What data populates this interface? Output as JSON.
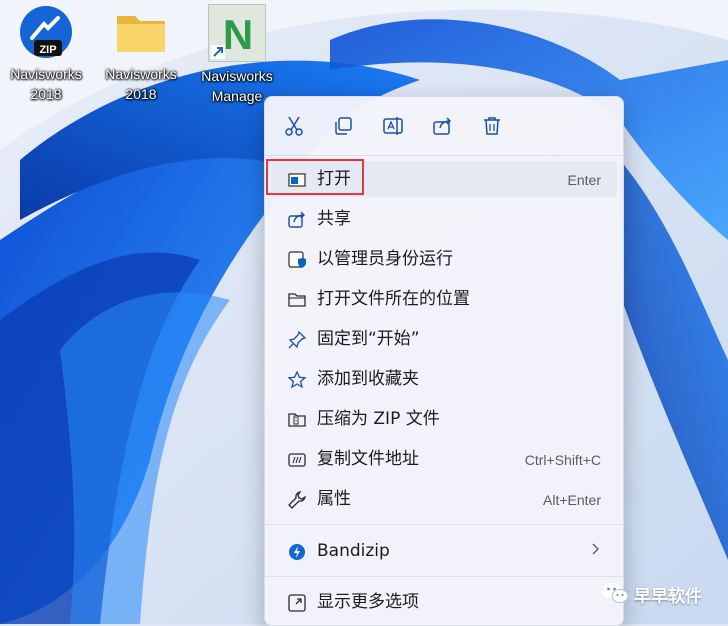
{
  "desktop": {
    "icons": [
      {
        "label": "Navisworks\n2018",
        "badge": "ZIP"
      },
      {
        "label": "Navisworks\n2018"
      },
      {
        "label": "Navisworks\nManage",
        "letter": "N"
      }
    ]
  },
  "context_menu": {
    "toolbar": [
      "cut-icon",
      "copy-icon",
      "rename-icon",
      "share-icon",
      "delete-icon"
    ],
    "items": [
      {
        "label": "打开",
        "shortcut": "Enter"
      },
      {
        "label": "共享",
        "shortcut": ""
      },
      {
        "label": "以管理员身份运行",
        "shortcut": ""
      },
      {
        "label": "打开文件所在的位置",
        "shortcut": ""
      },
      {
        "label": "固定到“开始”",
        "shortcut": ""
      },
      {
        "label": "添加到收藏夹",
        "shortcut": ""
      },
      {
        "label": "压缩为 ZIP 文件",
        "shortcut": ""
      },
      {
        "label": "复制文件地址",
        "shortcut": "Ctrl+Shift+C"
      },
      {
        "label": "属性",
        "shortcut": "Alt+Enter"
      },
      {
        "label": "Bandizip",
        "shortcut": ""
      },
      {
        "label": "显示更多选项",
        "shortcut": ""
      }
    ]
  },
  "watermark": {
    "text": "早早软件"
  },
  "colors": {
    "accent": "#0067c0",
    "highlight_border": "#e4393c"
  }
}
